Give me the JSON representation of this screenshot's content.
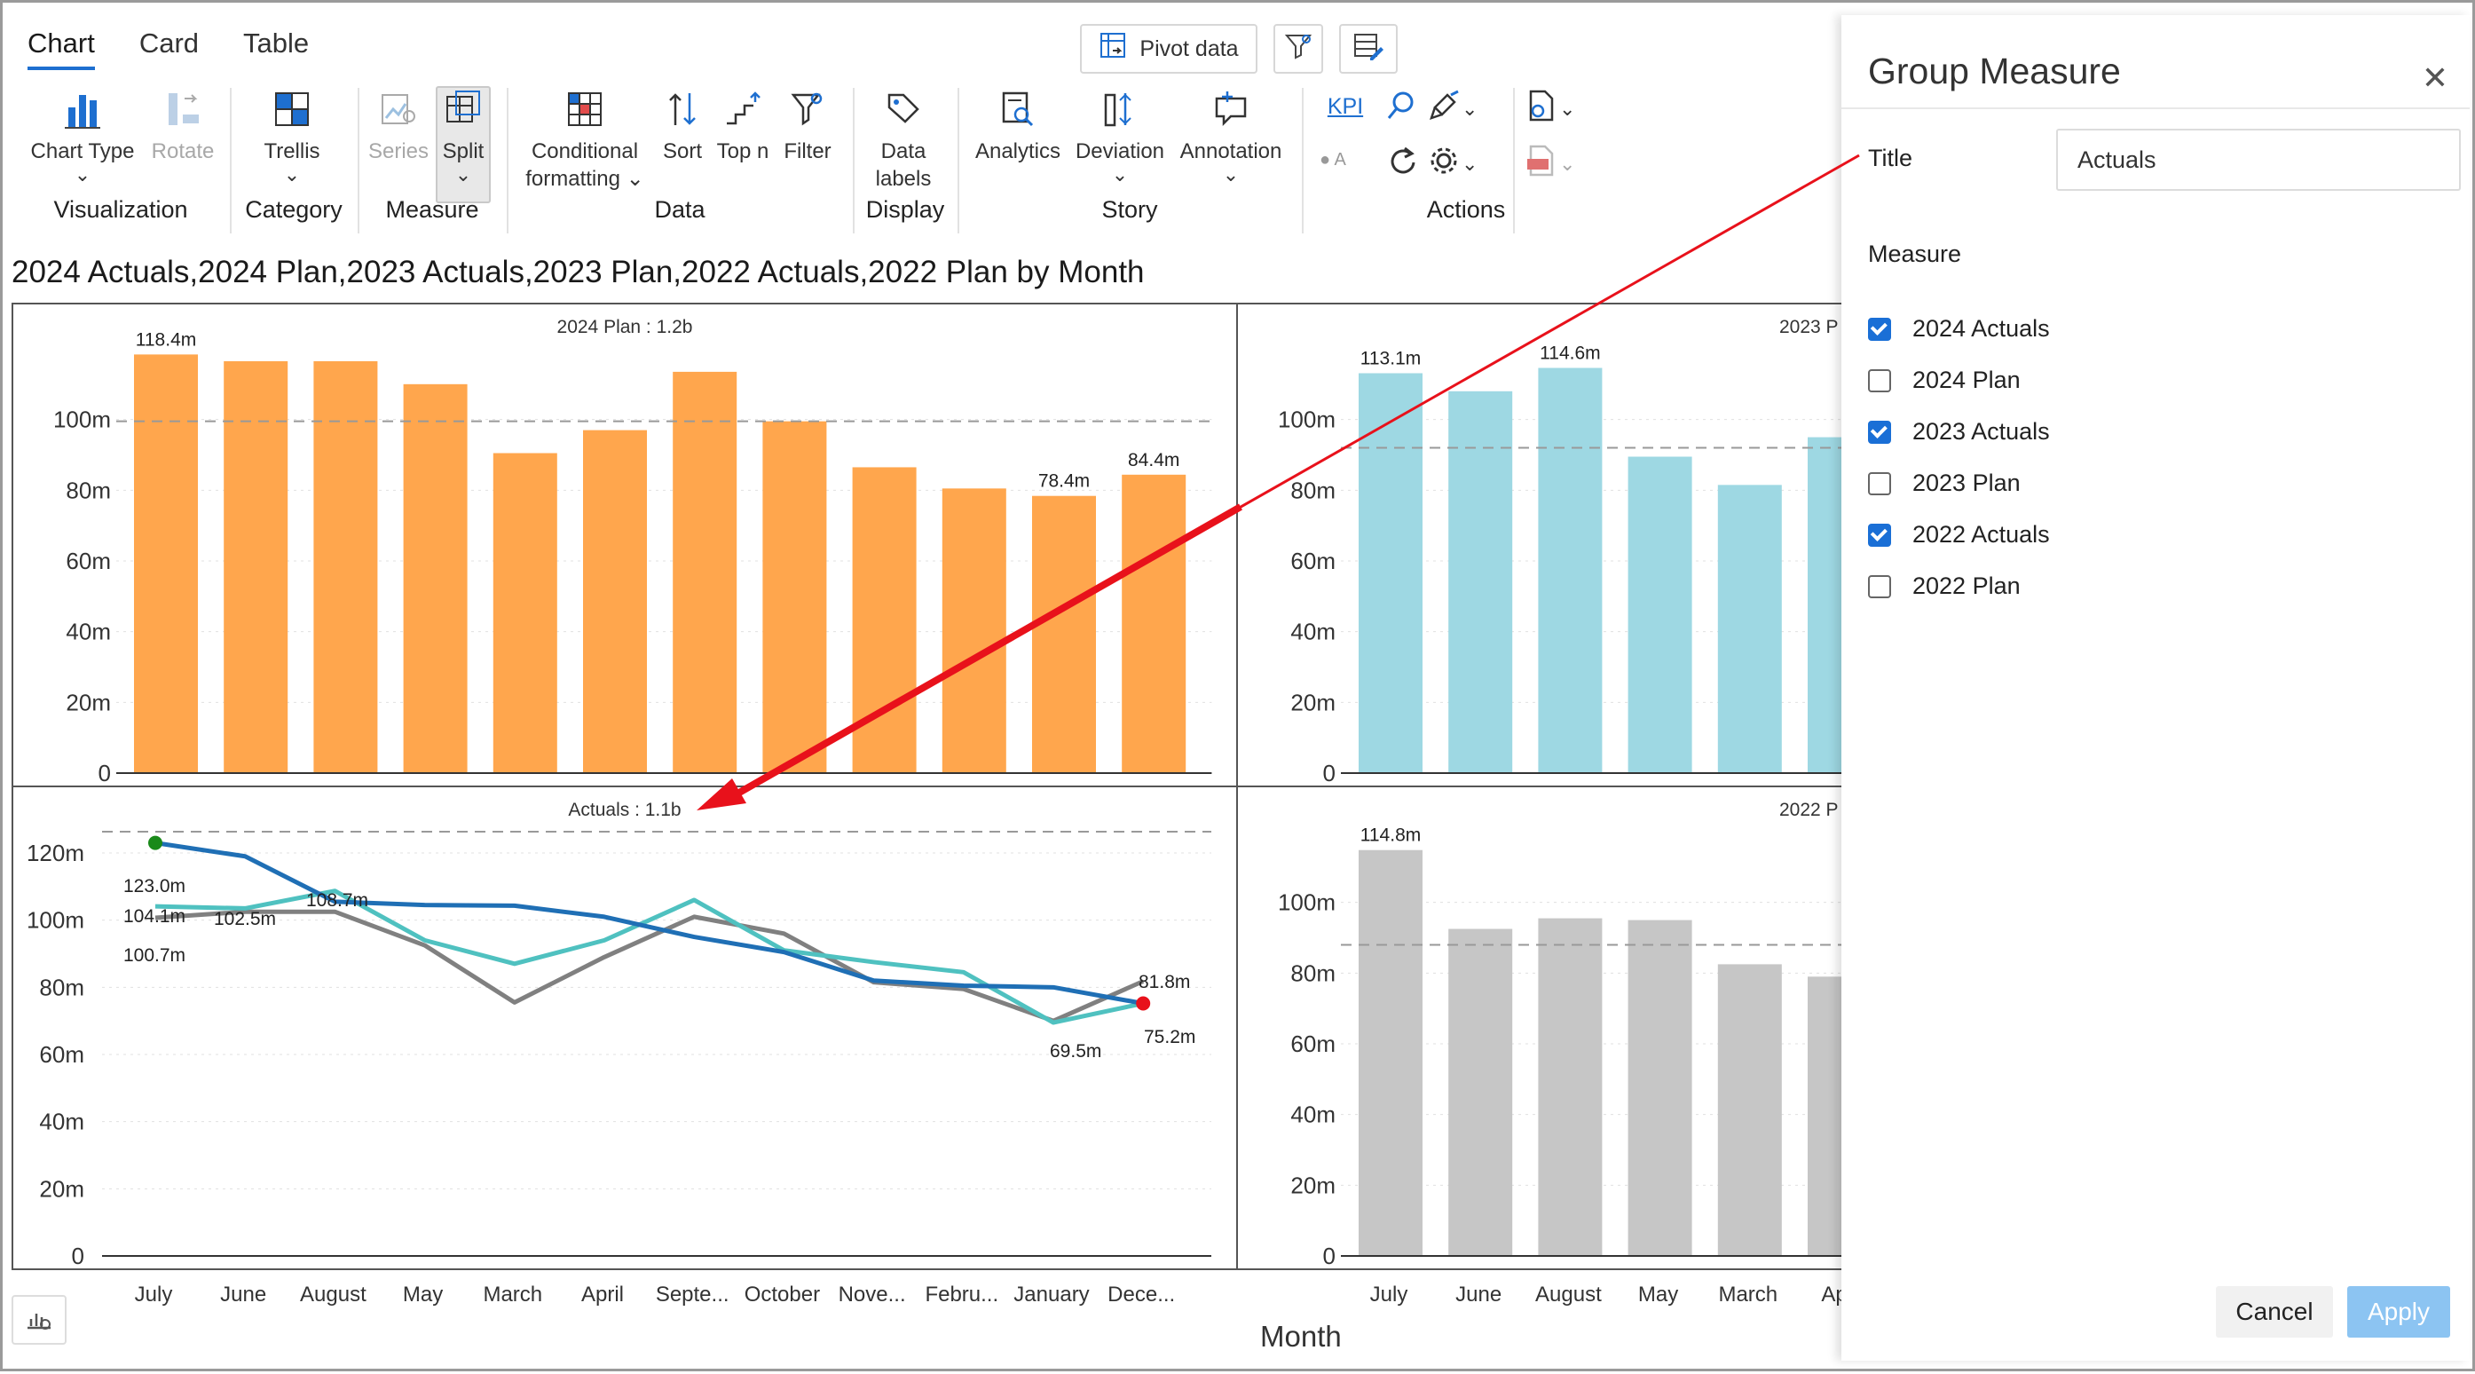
{
  "tabs": [
    "Chart",
    "Card",
    "Table"
  ],
  "top_buttons": {
    "pivot": "Pivot data"
  },
  "ribbon": {
    "chart_type": "Chart Type",
    "rotate": "Rotate",
    "trellis": "Trellis",
    "series": "Series",
    "split": "Split",
    "conditional_1": "Conditional",
    "conditional_2": "formatting",
    "sort": "Sort",
    "topn": "Top n",
    "filter": "Filter",
    "datalabels_1": "Data",
    "datalabels_2": "labels",
    "analytics": "Analytics",
    "deviation": "Deviation",
    "annotation": "Annotation",
    "kpi": "KPI",
    "groups": {
      "visualization": "Visualization",
      "category": "Category",
      "measure": "Measure",
      "data": "Data",
      "display": "Display",
      "story": "Story",
      "actions": "Actions"
    }
  },
  "chart_title": "2024 Actuals,2024 Plan,2023 Actuals,2023 Plan,2022 Actuals,2022 Plan by Month",
  "x_axis_title": "Month",
  "months": [
    "July",
    "June",
    "August",
    "May",
    "March",
    "April",
    "Septe...",
    "October",
    "Nove...",
    "Febru...",
    "January",
    "Dece..."
  ],
  "right_months": [
    "July",
    "June",
    "August",
    "May",
    "March",
    "Apr"
  ],
  "panel_titles": {
    "top_left": "2024 Plan :  1.2b",
    "top_right": "2023 P",
    "bottom_left": "Actuals :  1.1b",
    "bottom_right": "2022 P"
  },
  "chart_data": [
    {
      "type": "bar",
      "name": "2024 Plan",
      "color": "#FFA64D",
      "categories": [
        "July",
        "June",
        "August",
        "May",
        "March",
        "April",
        "Septe...",
        "October",
        "Nove...",
        "Febru...",
        "January",
        "Dece..."
      ],
      "values": [
        118.4,
        116.5,
        116.5,
        110.0,
        90.5,
        97.0,
        113.5,
        99.5,
        86.5,
        80.5,
        78.4,
        84.4
      ],
      "data_labels": {
        "0": "118.4m",
        "10": "78.4m",
        "11": "84.4m"
      },
      "yticks": [
        "0",
        "20m",
        "40m",
        "60m",
        "80m",
        "100m"
      ],
      "ylim": [
        0,
        120
      ],
      "reference_line": 99.5
    },
    {
      "type": "bar",
      "name": "2023 Plan",
      "color": "#9ED8E3",
      "categories": [
        "July",
        "June",
        "August",
        "May",
        "March",
        "April"
      ],
      "values": [
        113.1,
        108.0,
        114.6,
        89.5,
        81.5,
        95.0
      ],
      "data_labels": {
        "0": "113.1m",
        "2": "114.6m"
      },
      "yticks": [
        "0",
        "20m",
        "40m",
        "60m",
        "80m",
        "100m"
      ],
      "ylim": [
        0,
        120
      ],
      "reference_line": 92.0
    },
    {
      "type": "line",
      "name": "Actuals",
      "categories": [
        "July",
        "June",
        "August",
        "May",
        "March",
        "April",
        "Septe...",
        "October",
        "Nove...",
        "Febru...",
        "January",
        "Dece..."
      ],
      "ylim": [
        0,
        130
      ],
      "yticks": [
        "0",
        "20m",
        "40m",
        "60m",
        "80m",
        "100m",
        "120m"
      ],
      "reference_line": 136,
      "series": [
        {
          "color": "#1F6FB5",
          "values": [
            123.0,
            119.0,
            105.5,
            104.5,
            104.3,
            101.0,
            95.0,
            90.5,
            82.0,
            80.5,
            80.0,
            75.2
          ]
        },
        {
          "color": "#4FC1C0",
          "values": [
            104.1,
            103.5,
            108.7,
            94.0,
            87.0,
            94.0,
            106.0,
            91.0,
            87.5,
            84.5,
            69.5,
            75.2
          ]
        },
        {
          "color": "#808080",
          "values": [
            100.7,
            102.5,
            102.5,
            92.5,
            75.5,
            89.0,
            101.0,
            96.0,
            81.5,
            79.5,
            70.0,
            81.8
          ]
        }
      ],
      "data_labels": [
        {
          "text": "123.0m"
        },
        {
          "text": "104.1m"
        },
        {
          "text": "100.7m"
        },
        {
          "text": "102.5m"
        },
        {
          "text": "108.7m"
        },
        {
          "text": "81.8m"
        },
        {
          "text": "69.5m"
        },
        {
          "text": "75.2m"
        }
      ]
    },
    {
      "type": "bar",
      "name": "2022 Plan",
      "color": "#C6C6C6",
      "categories": [
        "July",
        "June",
        "August",
        "May",
        "March",
        "April"
      ],
      "values": [
        114.8,
        92.5,
        95.5,
        95.0,
        82.5,
        79.0
      ],
      "data_labels": {
        "0": "114.8m"
      },
      "yticks": [
        "0",
        "20m",
        "40m",
        "60m",
        "80m",
        "100m"
      ],
      "ylim": [
        0,
        120
      ],
      "reference_line": 88.0
    }
  ],
  "dialog": {
    "title": "Group Measure",
    "title_label": "Title",
    "title_value": "Actuals",
    "measure_label": "Measure",
    "measures": [
      {
        "label": "2024 Actuals",
        "checked": true
      },
      {
        "label": "2024 Plan",
        "checked": false
      },
      {
        "label": "2023 Actuals",
        "checked": true
      },
      {
        "label": "2023 Plan",
        "checked": false
      },
      {
        "label": "2022 Actuals",
        "checked": true
      },
      {
        "label": "2022 Plan",
        "checked": false
      }
    ],
    "cancel": "Cancel",
    "apply": "Apply"
  },
  "colors": {
    "accent": "#1e6fd0",
    "arrow": "#e8111b"
  }
}
